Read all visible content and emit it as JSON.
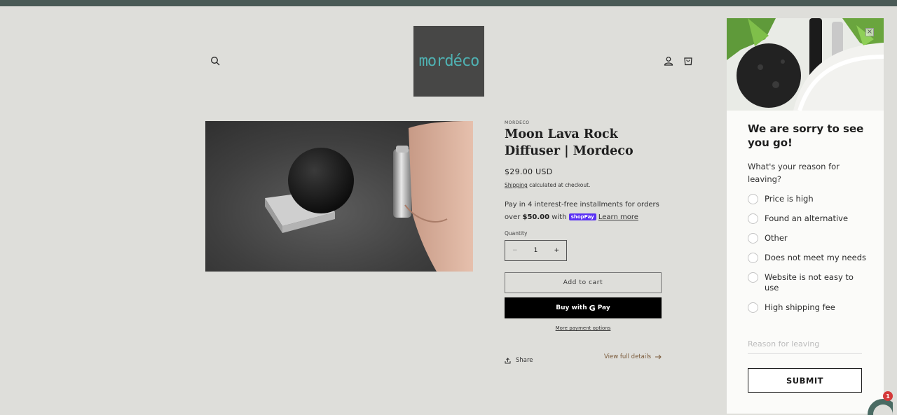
{
  "header": {
    "logo_text": "mordéco",
    "icons": [
      "search-icon",
      "account-icon",
      "cart-icon"
    ]
  },
  "product": {
    "vendor": "MORDECO",
    "title": "Moon Lava Rock Diffuser | Mordeco",
    "price": "$29.00 USD",
    "shipping_link": "Shipping",
    "shipping_suffix": "calculated at checkout.",
    "installments_text": "Pay in 4 interest-free installments for orders over",
    "installments_amount": "$50.00",
    "installments_with": "with",
    "shop_pay_label": "shopPay",
    "learn_more": "Learn more",
    "quantity_label": "Quantity",
    "quantity_value": "1",
    "minus_label": "−",
    "plus_label": "+",
    "add_to_cart": "Add to cart",
    "buy_with": "Buy with",
    "gpay_g": "G",
    "gpay_pay": "Pay",
    "more_payment": "More payment options",
    "share": "Share",
    "view_details": "View full details"
  },
  "popup": {
    "close_label": "×",
    "title": "We are sorry to see you go!",
    "question": "What's your reason for leaving?",
    "options": [
      "Price is high",
      "Found an alternative",
      "Other",
      "Does not meet my needs",
      "Website is not easy to use",
      "High shipping fee"
    ],
    "reason_placeholder": "Reason for leaving",
    "submit": "SUBMIT"
  },
  "chat": {
    "badge": "1"
  },
  "colors": {
    "page_bg": "#dededa",
    "top_bar": "#4a5a56",
    "logo_bg": "#474746",
    "logo_text": "#4fb2b3",
    "shop_pay": "#5a31f4",
    "badge": "#d43a3a"
  }
}
